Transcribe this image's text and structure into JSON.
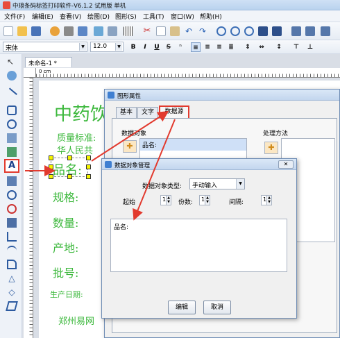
{
  "app": {
    "title": "中琅条码标签打印软件-V6.1.2 试用版 单机"
  },
  "menu": [
    "文件(F)",
    "编辑(E)",
    "查看(V)",
    "绘图(D)",
    "图形(S)",
    "工具(T)",
    "窗口(W)",
    "帮助(H)"
  ],
  "format": {
    "font_name": "宋体",
    "font_size": "12.0",
    "bold": "B",
    "italic": "I",
    "underline": "U",
    "strike": "S"
  },
  "document": {
    "tab_title": "未命名-1 *",
    "ruler_start": "0 cm"
  },
  "canvas_labels": {
    "title": "中药饮",
    "line2": "质量标准:",
    "line3": "华人民共",
    "pinming": "品名:",
    "guige": "规格:",
    "shuliang": "数量:",
    "chandi": "产地:",
    "pihao": "批号:",
    "shengchan": "生产日期:",
    "company": "郑州易网"
  },
  "shape_dialog": {
    "title": "图形属性",
    "tabs": [
      "基本",
      "文字",
      "数据源"
    ],
    "data_object_label": "数据对象",
    "data_list_item": "品名:",
    "process_label": "处理方法"
  },
  "data_dialog": {
    "title": "数据对象管理",
    "type_label": "数据对象类型:",
    "type_value": "手动输入",
    "start_label": "起始",
    "start_value": "1",
    "count_label": "份数:",
    "count_value": "1",
    "interval_label": "间隔:",
    "interval_value": "1",
    "content_value": "品名:",
    "edit_button": "编辑",
    "cancel_button": "取消",
    "close_glyph": "✕"
  },
  "colors": {
    "accent_red": "#e23a2e",
    "label_green": "#3cb83c",
    "title_blue": "#c3d6ee"
  }
}
